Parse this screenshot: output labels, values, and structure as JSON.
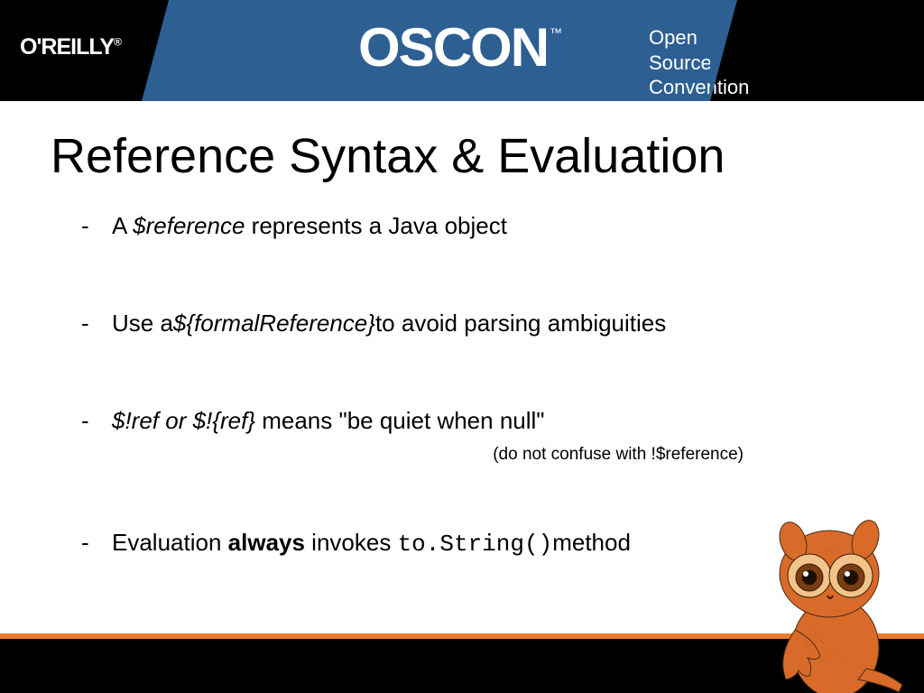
{
  "header": {
    "publisher": "O'REILLY",
    "event": "OSCON",
    "tm": "™",
    "tagline_line1": "Open Source",
    "tagline_line2": "Convention"
  },
  "title": "Reference Syntax & Evaluation",
  "bullets": {
    "b1_pre": "A  ",
    "b1_ref": "$reference",
    "b1_post": " represents a Java object",
    "b2_pre": "Use a",
    "b2_ref": "${formalReference}",
    "b2_post": "to avoid parsing ambiguities",
    "b3_ref": "$!ref or $!{ref}",
    "b3_post": " means \"be quiet when null\"",
    "b3_note": "(do not confuse with !$reference)",
    "b4_pre": "Evaluation ",
    "b4_bold": "always",
    "b4_mid": " invokes ",
    "b4_code": "to.String()",
    "b4_post": "method"
  },
  "dash": "-"
}
